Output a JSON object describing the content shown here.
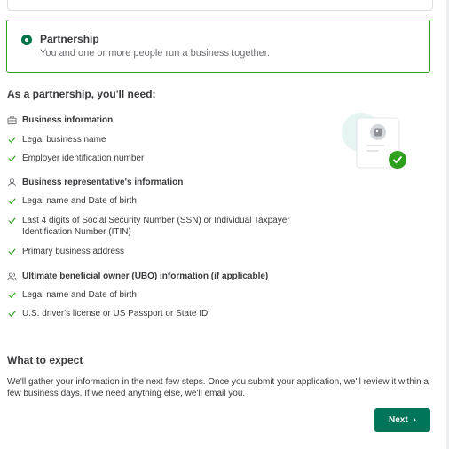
{
  "option": {
    "title": "Partnership",
    "description": "You and one or more people run a business together.",
    "selected": true
  },
  "needs": {
    "heading": "As a partnership, you'll need:",
    "sections": {
      "business": {
        "title": "Business information",
        "icon": "briefcase-icon",
        "items": [
          "Legal business name",
          "Employer identification number"
        ]
      },
      "representative": {
        "title": "Business representative's information",
        "icon": "person-icon",
        "items": [
          "Legal name and Date of birth",
          "Last 4 digits of Social Security Number (SSN) or Individual Taxpayer Identification Number (ITIN)",
          "Primary business address"
        ]
      },
      "ubo": {
        "title": "Ultimate beneficial owner (UBO) information (if applicable)",
        "icon": "people-icon",
        "items": [
          "Legal name and Date of birth",
          "U.S. driver's license or US Passport or State ID"
        ]
      }
    }
  },
  "expect": {
    "heading": "What to expect",
    "text": "We'll gather your information in the next few steps. Once you submit your application, we'll review it within a few business days. If we need anything else, we'll email you."
  },
  "footer": {
    "next_label": "Next"
  },
  "colors": {
    "accent": "#00755a",
    "selected_border": "#2ca01c",
    "check": "#2ca01c"
  }
}
